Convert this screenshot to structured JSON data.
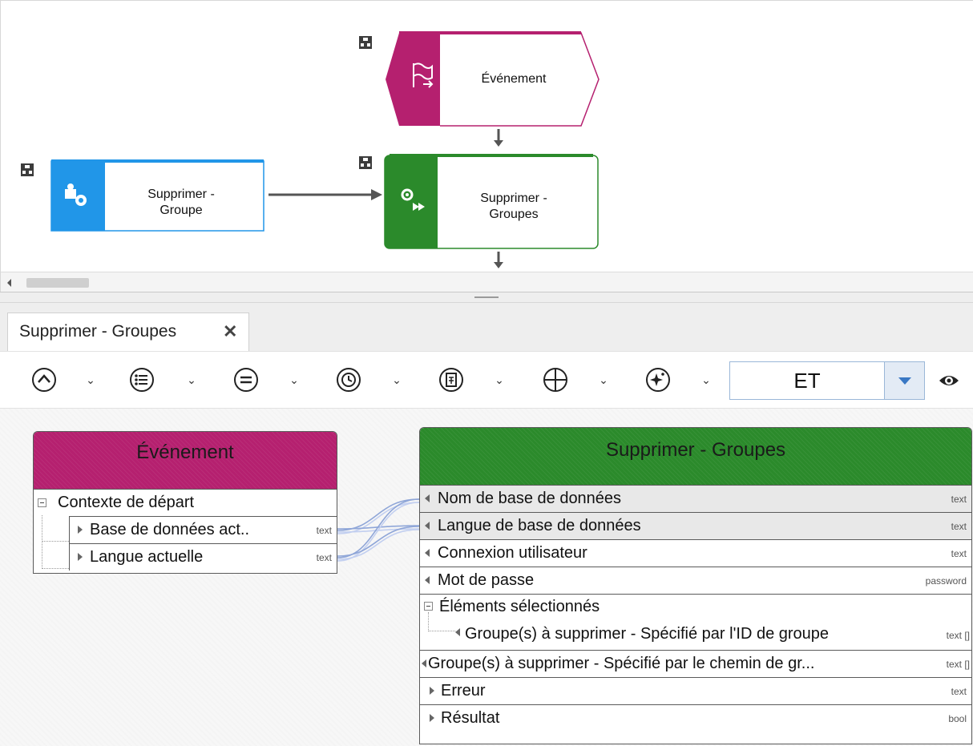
{
  "process": {
    "event_node_label": "Événement",
    "function_node_label_line1": "Supprimer -",
    "function_node_label_line2": "Groupes",
    "interface_node_label_line1": "Supprimer -",
    "interface_node_label_line2": "Groupe",
    "colors": {
      "event": "#b5206f",
      "function": "#2b8a2b",
      "interface": "#2196e8",
      "connector": "#555555"
    }
  },
  "tab": {
    "label": "Supprimer - Groupes",
    "close_icon": "close-icon"
  },
  "toolbar": {
    "buttons": [
      "caret-up-circle-icon",
      "list-circle-icon",
      "equals-circle-icon",
      "clock-circle-icon",
      "document-circle-icon",
      "plus-circle-icon",
      "magic-circle-icon"
    ],
    "operator_select_value": "ET"
  },
  "source_box": {
    "title": "Événement",
    "header_color": "#b5206f",
    "group_label": "Contexte de départ",
    "rows": [
      {
        "label": "Base de données act..",
        "type": "text"
      },
      {
        "label": "Langue actuelle",
        "type": "text"
      }
    ]
  },
  "target_box": {
    "title": "Supprimer - Groupes",
    "header_color": "#2b8a2b",
    "rows": [
      {
        "label": "Nom de base de données",
        "type": "text"
      },
      {
        "label": "Langue de base de données",
        "type": "text"
      },
      {
        "label": "Connexion utilisateur",
        "type": "text"
      },
      {
        "label": "Mot de passe",
        "type": "password"
      }
    ],
    "group_label": "Éléments sélectionnés",
    "group_child": {
      "label": "Groupe(s) à supprimer - Spécifié par l'ID de groupe",
      "type": "text []"
    },
    "rows2": [
      {
        "label": "Groupe(s) à supprimer - Spécifié par le chemin de gr...",
        "type": "text []"
      },
      {
        "label": "Erreur",
        "type": "text"
      },
      {
        "label": "Résultat",
        "type": "bool"
      }
    ]
  }
}
